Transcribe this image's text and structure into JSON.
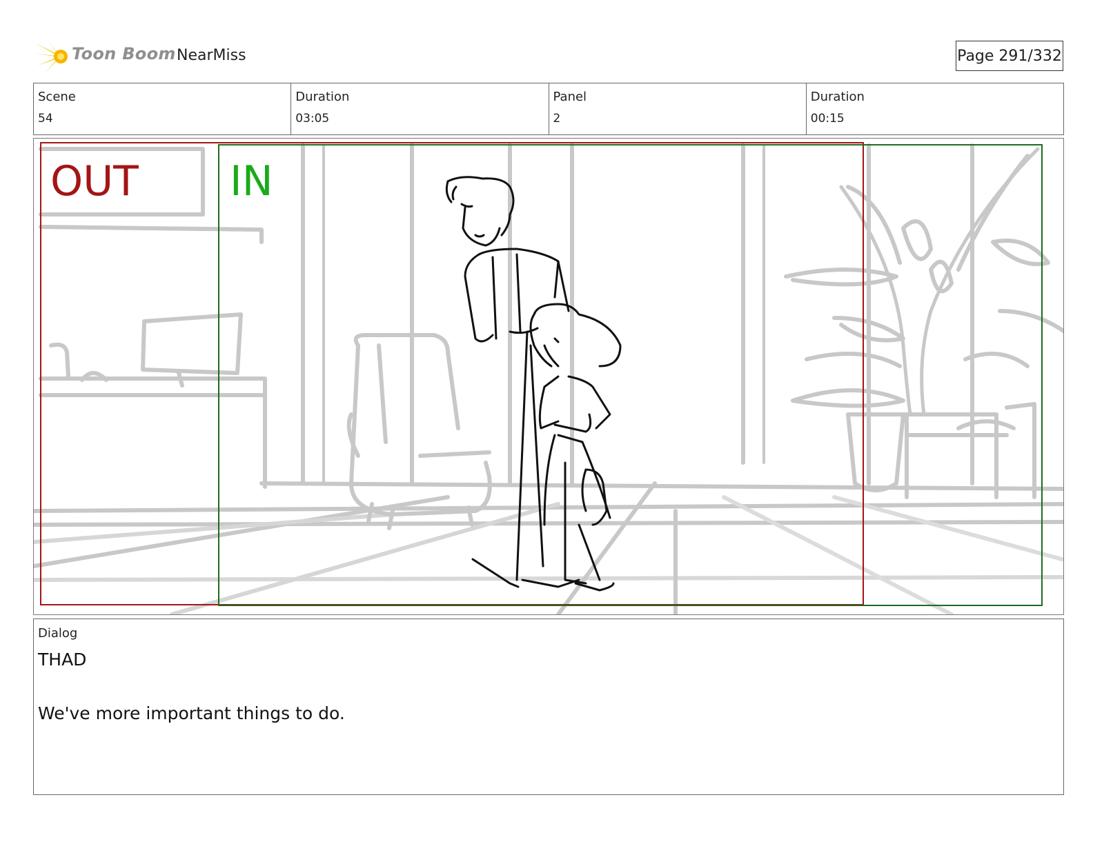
{
  "header": {
    "logo_text": "Toon Boom",
    "project_name": "NearMiss",
    "page_label": "Page 291/332"
  },
  "info": {
    "scene_label": "Scene",
    "scene_value": "54",
    "scene_duration_label": "Duration",
    "scene_duration_value": "03:05",
    "panel_label": "Panel",
    "panel_value": "2",
    "panel_duration_label": "Duration",
    "panel_duration_value": "00:15"
  },
  "panel": {
    "out_label": "OUT",
    "in_label": "IN",
    "out_color": "#a31515",
    "in_color": "#1aaa1a"
  },
  "dialog": {
    "label": "Dialog",
    "speaker": "THAD",
    "line": "We've more important things to do."
  }
}
